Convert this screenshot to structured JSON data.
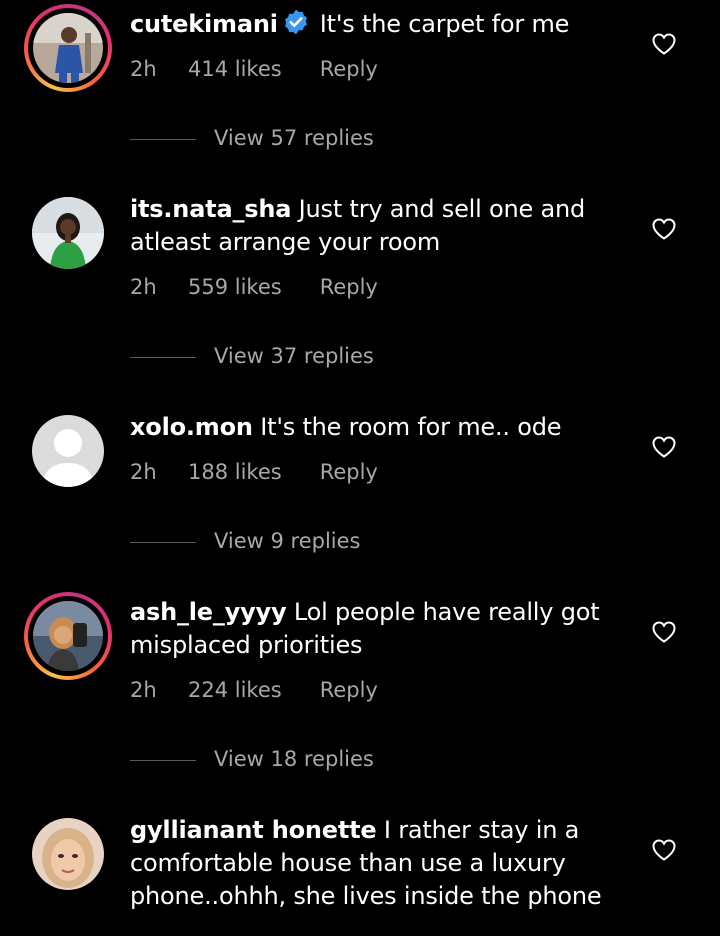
{
  "comments": [
    {
      "username": "cutekimani",
      "verified": true,
      "text": "It's the carpet for me",
      "time": "2h",
      "likes": "414 likes",
      "reply": "Reply",
      "view_replies": "View 57 replies",
      "avatar_icon": "user-photo",
      "story_ring": true
    },
    {
      "username": "its.nata_sha",
      "verified": false,
      "text": "Just try and sell one and atleast arrange your room",
      "time": "2h",
      "likes": "559 likes",
      "reply": "Reply",
      "view_replies": "View 37 replies",
      "avatar_icon": "user-photo",
      "story_ring": false
    },
    {
      "username": "xolo.mon",
      "verified": false,
      "text": "It's the room for me.. ode",
      "time": "2h",
      "likes": "188 likes",
      "reply": "Reply",
      "view_replies": "View 9 replies",
      "avatar_icon": "default-avatar",
      "story_ring": false
    },
    {
      "username": "ash_le_yyyy",
      "verified": false,
      "text": "Lol people have really got misplaced priorities",
      "time": "2h",
      "likes": "224 likes",
      "reply": "Reply",
      "view_replies": "View 18 replies",
      "avatar_icon": "user-photo",
      "story_ring": true
    },
    {
      "username": "gyllianant honette",
      "verified": false,
      "text": "I rather stay in a comfortable house than use a luxury phone..ohhh, she lives inside the phone",
      "avatar_icon": "user-photo",
      "story_ring": false
    }
  ],
  "colors": {
    "background": "#000000",
    "text": "#ffffff",
    "secondary_text": "#a8a8a8",
    "verified_badge": "#3897f0"
  },
  "icons": {
    "like": "heart-outline-icon",
    "verified": "verified-badge-icon"
  }
}
